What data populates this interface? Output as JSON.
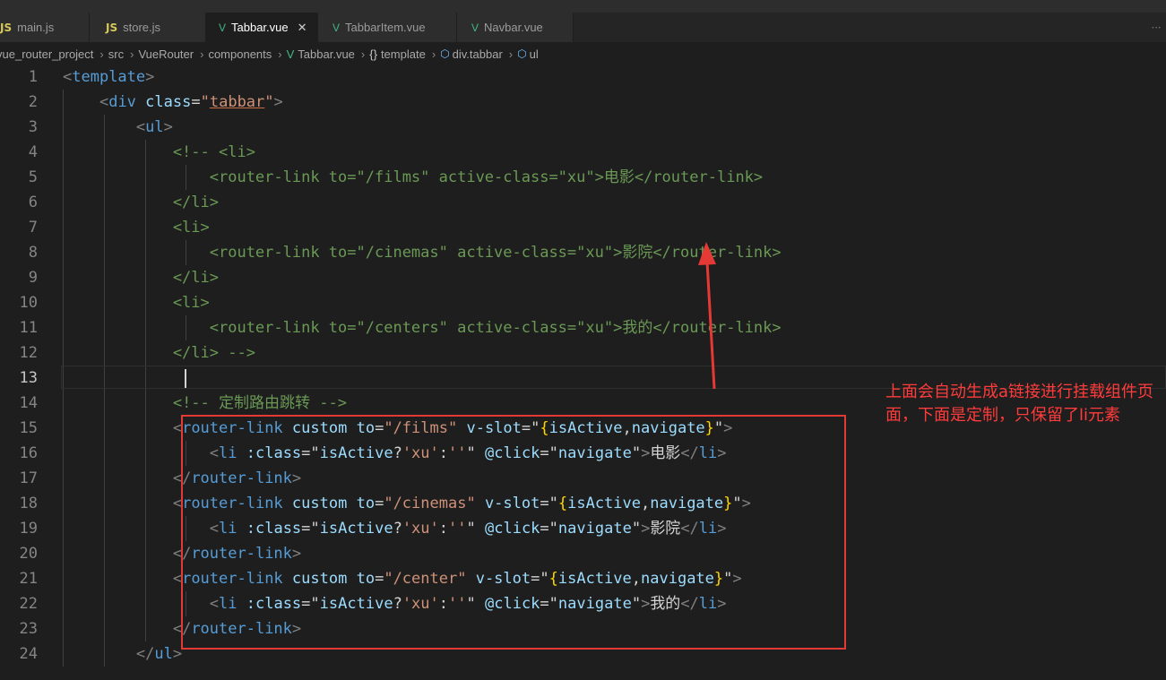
{
  "tabs": [
    {
      "name": "main.js",
      "type": "js"
    },
    {
      "name": "store.js",
      "type": "js"
    },
    {
      "name": "Tabbar.vue",
      "type": "vue",
      "active": true
    },
    {
      "name": "TabbarItem.vue",
      "type": "vue"
    },
    {
      "name": "Navbar.vue",
      "type": "vue"
    }
  ],
  "tab_icons": {
    "js": "JS",
    "vue": "V",
    "close": "✕"
  },
  "breadcrumb": {
    "items": [
      "vue_router_project",
      "src",
      "VueRouter",
      "components",
      "Tabbar.vue",
      "template",
      "div.tabbar",
      "ul"
    ],
    "template_icon": "{}"
  },
  "editor": {
    "current_line": 13,
    "line_numbers": [
      "1",
      "2",
      "3",
      "4",
      "5",
      "6",
      "7",
      "8",
      "9",
      "10",
      "11",
      "12",
      "13",
      "14",
      "15",
      "16",
      "17",
      "18",
      "19",
      "20",
      "21",
      "22",
      "23",
      "24"
    ],
    "lines": [
      "<template>",
      "    <div class=\"tabbar\">",
      "        <ul>",
      "            <!-- <li>",
      "                <router-link to=\"/films\" active-class=\"xu\">电影</router-link>",
      "            </li>",
      "            <li>",
      "                <router-link to=\"/cinemas\" active-class=\"xu\">影院</router-link>",
      "            </li>",
      "            <li>",
      "                <router-link to=\"/centers\" active-class=\"xu\">我的</router-link>",
      "            </li> -->",
      "",
      "            <!-- 定制路由跳转 -->",
      "            <router-link custom to=\"/films\" v-slot=\"{isActive,navigate}\">",
      "                <li :class=\"isActive?'xu':''\" @click=\"navigate\">电影</li>",
      "            </router-link>",
      "            <router-link custom to=\"/cinemas\" v-slot=\"{isActive,navigate}\">",
      "                <li :class=\"isActive?'xu':''\" @click=\"navigate\">影院</li>",
      "            </router-link>",
      "            <router-link custom to=\"/center\" v-slot=\"{isActive,navigate}\">",
      "                <li :class=\"isActive?'xu':''\" @click=\"navigate\">我的</li>",
      "            </router-link>",
      "        </ul>"
    ]
  },
  "annotation": {
    "text": "上面会自动生成a链接进行挂载组件页面，下面是定制，只保留了li元素",
    "color": "#ff3b3b"
  },
  "colors": {
    "editor_bg": "#1e1e1e",
    "tag": "#569cd6",
    "attr": "#9cdcfe",
    "string": "#ce9178",
    "comment": "#6a9955",
    "brace": "#ffd700",
    "annotation_red": "#e53935"
  }
}
